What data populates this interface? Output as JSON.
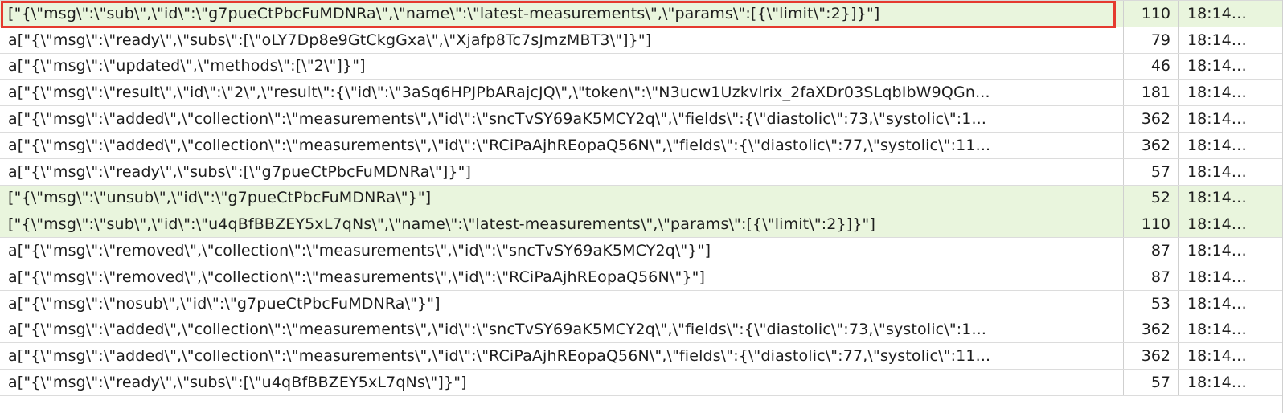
{
  "frames": [
    {
      "data": "[\"{\\\"msg\\\":\\\"sub\\\",\\\"id\\\":\\\"g7pueCtPbcFuMDNRa\\\",\\\"name\\\":\\\"latest-measurements\\\",\\\"params\\\":[{\\\"limit\\\":2}]}\"]",
      "length": "110",
      "time": "18:14:...",
      "direction": "sent",
      "highlighted": true
    },
    {
      "data": "a[\"{\\\"msg\\\":\\\"ready\\\",\\\"subs\\\":[\\\"oLY7Dp8e9GtCkgGxa\\\",\\\"Xjafp8Tc7sJmzMBT3\\\"]}\"]",
      "length": "79",
      "time": "18:14:...",
      "direction": "received"
    },
    {
      "data": "a[\"{\\\"msg\\\":\\\"updated\\\",\\\"methods\\\":[\\\"2\\\"]}\"]",
      "length": "46",
      "time": "18:14:...",
      "direction": "received"
    },
    {
      "data": "a[\"{\\\"msg\\\":\\\"result\\\",\\\"id\\\":\\\"2\\\",\\\"result\\\":{\\\"id\\\":\\\"3aSq6HPJPbARajcJQ\\\",\\\"token\\\":\\\"N3ucw1Uzkvlrix_2faXDr03SLqbIbW9QGn...",
      "length": "181",
      "time": "18:14:...",
      "direction": "received"
    },
    {
      "data": "a[\"{\\\"msg\\\":\\\"added\\\",\\\"collection\\\":\\\"measurements\\\",\\\"id\\\":\\\"sncTvSY69aK5MCY2q\\\",\\\"fields\\\":{\\\"diastolic\\\":73,\\\"systolic\\\":1...",
      "length": "362",
      "time": "18:14:...",
      "direction": "received"
    },
    {
      "data": "a[\"{\\\"msg\\\":\\\"added\\\",\\\"collection\\\":\\\"measurements\\\",\\\"id\\\":\\\"RCiPaAjhREopaQ56N\\\",\\\"fields\\\":{\\\"diastolic\\\":77,\\\"systolic\\\":11...",
      "length": "362",
      "time": "18:14:...",
      "direction": "received"
    },
    {
      "data": "a[\"{\\\"msg\\\":\\\"ready\\\",\\\"subs\\\":[\\\"g7pueCtPbcFuMDNRa\\\"]}\"]",
      "length": "57",
      "time": "18:14:...",
      "direction": "received"
    },
    {
      "data": "[\"{\\\"msg\\\":\\\"unsub\\\",\\\"id\\\":\\\"g7pueCtPbcFuMDNRa\\\"}\"]",
      "length": "52",
      "time": "18:14:...",
      "direction": "sent"
    },
    {
      "data": "[\"{\\\"msg\\\":\\\"sub\\\",\\\"id\\\":\\\"u4qBfBBZEY5xL7qNs\\\",\\\"name\\\":\\\"latest-measurements\\\",\\\"params\\\":[{\\\"limit\\\":2}]}\"]",
      "length": "110",
      "time": "18:14:...",
      "direction": "sent"
    },
    {
      "data": "a[\"{\\\"msg\\\":\\\"removed\\\",\\\"collection\\\":\\\"measurements\\\",\\\"id\\\":\\\"sncTvSY69aK5MCY2q\\\"}\"]",
      "length": "87",
      "time": "18:14:...",
      "direction": "received"
    },
    {
      "data": "a[\"{\\\"msg\\\":\\\"removed\\\",\\\"collection\\\":\\\"measurements\\\",\\\"id\\\":\\\"RCiPaAjhREopaQ56N\\\"}\"]",
      "length": "87",
      "time": "18:14:...",
      "direction": "received"
    },
    {
      "data": "a[\"{\\\"msg\\\":\\\"nosub\\\",\\\"id\\\":\\\"g7pueCtPbcFuMDNRa\\\"}\"]",
      "length": "53",
      "time": "18:14:...",
      "direction": "received"
    },
    {
      "data": "a[\"{\\\"msg\\\":\\\"added\\\",\\\"collection\\\":\\\"measurements\\\",\\\"id\\\":\\\"sncTvSY69aK5MCY2q\\\",\\\"fields\\\":{\\\"diastolic\\\":73,\\\"systolic\\\":1...",
      "length": "362",
      "time": "18:14:...",
      "direction": "received"
    },
    {
      "data": "a[\"{\\\"msg\\\":\\\"added\\\",\\\"collection\\\":\\\"measurements\\\",\\\"id\\\":\\\"RCiPaAjhREopaQ56N\\\",\\\"fields\\\":{\\\"diastolic\\\":77,\\\"systolic\\\":11...",
      "length": "362",
      "time": "18:14:...",
      "direction": "received"
    },
    {
      "data": "a[\"{\\\"msg\\\":\\\"ready\\\",\\\"subs\\\":[\\\"u4qBfBBZEY5xL7qNs\\\"]}\"]",
      "length": "57",
      "time": "18:14:...",
      "direction": "received"
    }
  ],
  "colors": {
    "sent_row": "#e9f5dd",
    "received_row": "#ffffff",
    "highlight_border": "#e53a2f"
  }
}
